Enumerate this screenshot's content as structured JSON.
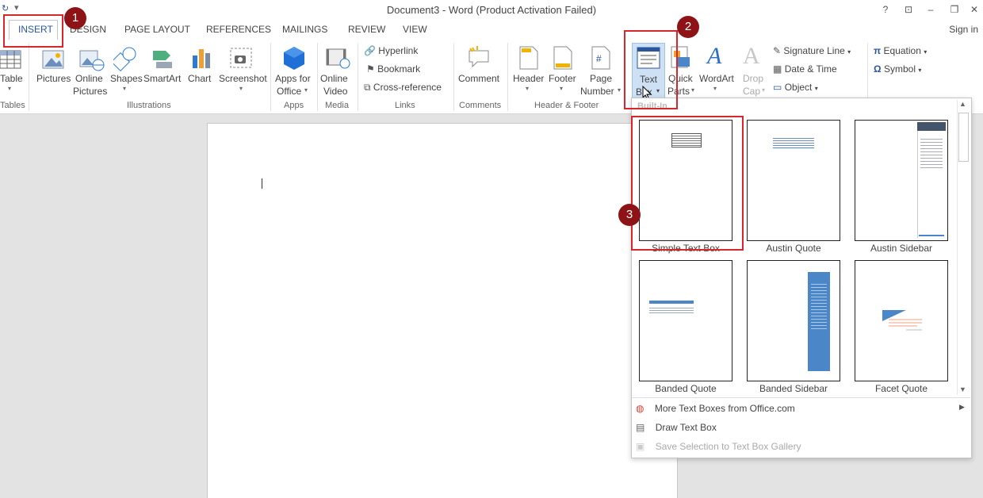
{
  "titlebar": {
    "title": "Document3 - Word (Product Activation Failed)",
    "help": "?",
    "sign_in": "Sign in"
  },
  "tabs": [
    "INSERT",
    "DESIGN",
    "PAGE LAYOUT",
    "REFERENCES",
    "MAILINGS",
    "REVIEW",
    "VIEW"
  ],
  "ribbon": {
    "table": "Table",
    "pictures": "Pictures",
    "online_pictures": [
      "Online",
      "Pictures"
    ],
    "shapes": "Shapes",
    "smartart": "SmartArt",
    "chart": "Chart",
    "screenshot": "Screenshot",
    "apps_for_office": [
      "Apps for",
      "Office"
    ],
    "online_video": [
      "Online",
      "Video"
    ],
    "hyperlink": "Hyperlink",
    "bookmark": "Bookmark",
    "cross_reference": "Cross-reference",
    "comment": "Comment",
    "header": "Header",
    "footer": "Footer",
    "page_number": [
      "Page",
      "Number"
    ],
    "text_box": [
      "Text",
      "Box"
    ],
    "quick_parts": [
      "Quick",
      "Parts"
    ],
    "wordart": "WordArt",
    "drop_cap": [
      "Drop",
      "Cap"
    ],
    "signature_line": "Signature Line",
    "date_time": "Date & Time",
    "object": "Object",
    "equation": "Equation",
    "symbol": "Symbol",
    "groups": [
      "Tables",
      "Illustrations",
      "Apps",
      "Media",
      "Links",
      "Comments",
      "Header & Footer"
    ]
  },
  "gallery": {
    "header": "Built-In",
    "items": [
      "Simple Text Box",
      "Austin Quote",
      "Austin Sidebar",
      "Banded Quote",
      "Banded Sidebar",
      "Facet Quote"
    ],
    "menu": [
      "More Text Boxes from Office.com",
      "Draw Text Box",
      "Save Selection to Text Box Gallery"
    ]
  },
  "badges": [
    "1",
    "2",
    "3"
  ],
  "colors": {
    "accent": "#2b579a",
    "callout": "#d9262a",
    "badge": "#8e1316",
    "banded_blue": "#4a86c8"
  }
}
